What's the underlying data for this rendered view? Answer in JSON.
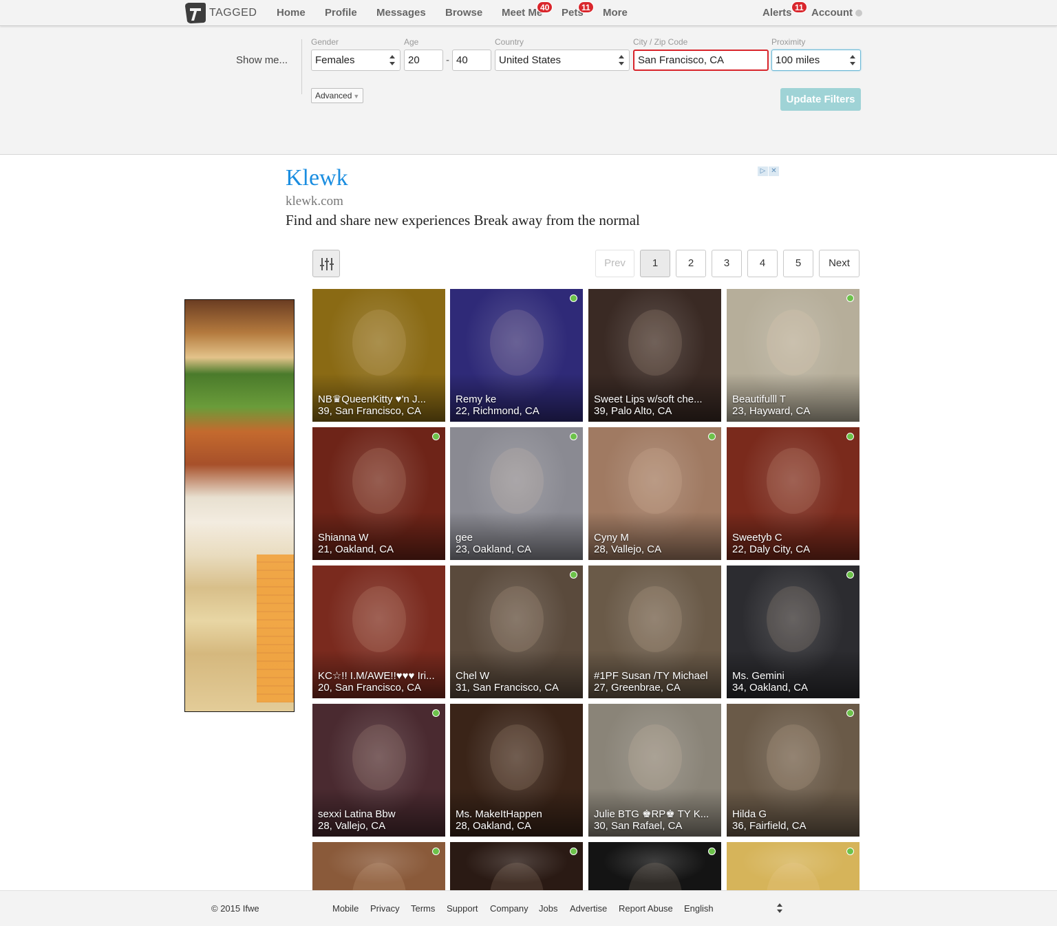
{
  "nav": {
    "logo_text": "TAGGED",
    "home": "Home",
    "profile": "Profile",
    "messages": "Messages",
    "browse": "Browse",
    "meet_me": "Meet Me",
    "meet_me_badge": "40",
    "pets": "Pets",
    "pets_badge": "11",
    "more": "More",
    "alerts": "Alerts",
    "alerts_badge": "11",
    "account": "Account"
  },
  "filters": {
    "show_me": "Show me...",
    "gender_label": "Gender",
    "gender_value": "Females",
    "age_label": "Age",
    "age_min": "20",
    "age_max": "40",
    "country_label": "Country",
    "country_value": "United States",
    "city_label": "City / Zip Code",
    "city_value": "San Francisco, CA",
    "proximity_label": "Proximity",
    "proximity_value": "100 miles",
    "advanced": "Advanced",
    "update": "Update Filters"
  },
  "ad": {
    "title": "Klewk",
    "domain": "klewk.com",
    "description": "Find and share new experiences Break away from the normal"
  },
  "pagination": {
    "prev": "Prev",
    "pages": [
      "1",
      "2",
      "3",
      "4",
      "5"
    ],
    "current": "1",
    "next": "Next"
  },
  "members": [
    {
      "name": "NB♛QueenKitty ♥'n J...",
      "meta": "39, San Francisco, CA",
      "online": false,
      "bg": "#8a6a14"
    },
    {
      "name": "Remy ke",
      "meta": "22, Richmond, CA",
      "online": true,
      "bg": "#2f2a78"
    },
    {
      "name": "Sweet Lips w/soft che...",
      "meta": "39, Palo Alto, CA",
      "online": false,
      "bg": "#3a2a24"
    },
    {
      "name": "Beautifulll T",
      "meta": "23, Hayward, CA",
      "online": true,
      "bg": "#b6ae9a"
    },
    {
      "name": "Shianna W",
      "meta": "21, Oakland, CA",
      "online": true,
      "bg": "#6e2418"
    },
    {
      "name": "gee",
      "meta": "23, Oakland, CA",
      "online": true,
      "bg": "#8a8a92"
    },
    {
      "name": "Cyny M",
      "meta": "28, Vallejo, CA",
      "online": true,
      "bg": "#a07a62"
    },
    {
      "name": "Sweetyb C",
      "meta": "22, Daly City, CA",
      "online": true,
      "bg": "#7a2a1c"
    },
    {
      "name": "KC☆!! I.M/AWE!!♥♥♥ Iri...",
      "meta": "20, San Francisco, CA",
      "online": false,
      "bg": "#7a2a1e"
    },
    {
      "name": "Chel W",
      "meta": "31, San Francisco, CA",
      "online": true,
      "bg": "#5a4a3c"
    },
    {
      "name": "#1PF Susan /TY Michael",
      "meta": "27, Greenbrae, CA",
      "online": false,
      "bg": "#6a5a48"
    },
    {
      "name": "Ms. Gemini",
      "meta": "34, Oakland, CA",
      "online": true,
      "bg": "#2c2c30"
    },
    {
      "name": "sexxi Latina Bbw",
      "meta": "28, Vallejo, CA",
      "online": true,
      "bg": "#4a2a30"
    },
    {
      "name": "Ms. MakeItHappen",
      "meta": "28, Oakland, CA",
      "online": false,
      "bg": "#3a2418"
    },
    {
      "name": "Julie BTG ♚RP♚ TY K...",
      "meta": "30, San Rafael, CA",
      "online": false,
      "bg": "#8a8478"
    },
    {
      "name": "Hilda G",
      "meta": "36, Fairfield, CA",
      "online": true,
      "bg": "#6a5a48"
    },
    {
      "name": "",
      "meta": "",
      "online": true,
      "bg": "#8a5a3a"
    },
    {
      "name": "",
      "meta": "",
      "online": true,
      "bg": "#2a1a14"
    },
    {
      "name": "",
      "meta": "",
      "online": true,
      "bg": "#141414"
    },
    {
      "name": "",
      "meta": "",
      "online": true,
      "bg": "#d6b45a"
    }
  ],
  "footer": {
    "copyright": "© 2015 Ifwe",
    "links": [
      "Mobile",
      "Privacy",
      "Terms",
      "Support",
      "Company",
      "Jobs",
      "Advertise",
      "Report Abuse",
      "English"
    ]
  }
}
